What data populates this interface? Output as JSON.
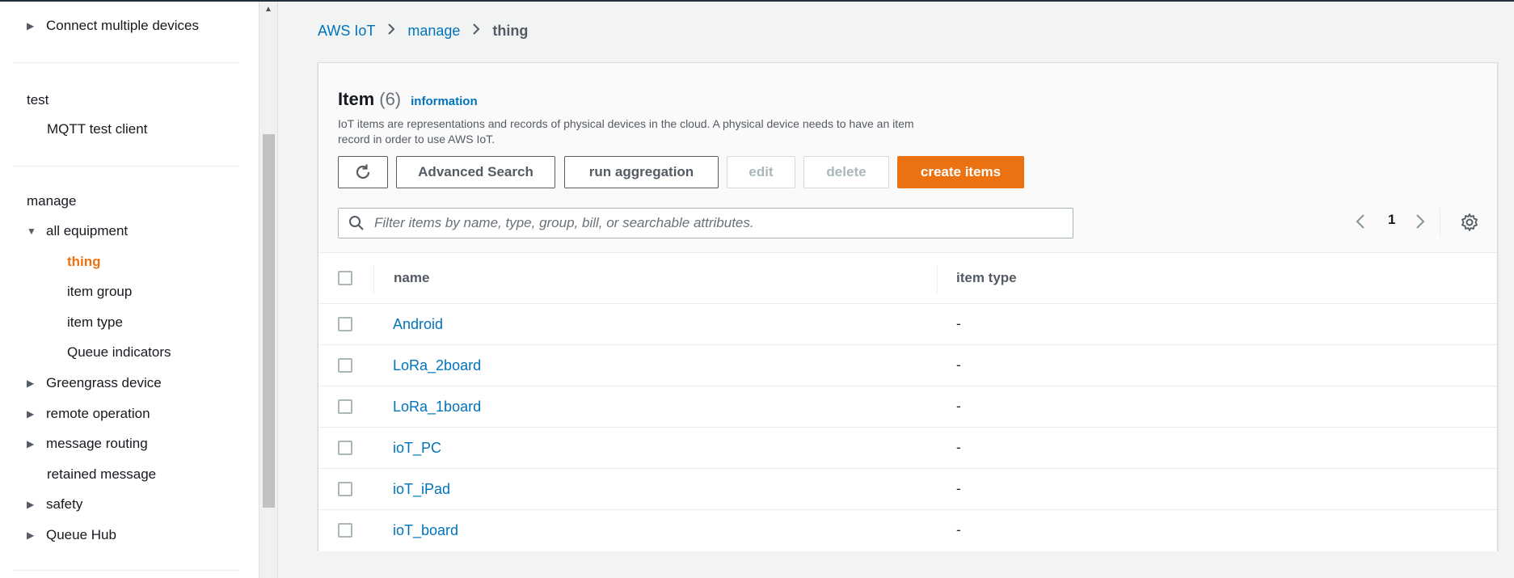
{
  "sidebar": {
    "items": [
      {
        "label": "Connect multiple devices",
        "caret": "right"
      },
      {
        "label": "MQTT test client"
      },
      {
        "label": "all equipment",
        "caret": "down"
      },
      {
        "label": "thing",
        "active": true
      },
      {
        "label": "item group"
      },
      {
        "label": "item type"
      },
      {
        "label": "Queue indicators"
      },
      {
        "label": "Greengrass device",
        "caret": "right"
      },
      {
        "label": "remote operation",
        "caret": "right"
      },
      {
        "label": "message routing",
        "caret": "right"
      },
      {
        "label": "retained message"
      },
      {
        "label": "safety",
        "caret": "right"
      },
      {
        "label": "Queue Hub",
        "caret": "right"
      }
    ],
    "sections": {
      "test": "test",
      "manage": "manage"
    }
  },
  "breadcrumb": {
    "root": "AWS IoT",
    "parent": "manage",
    "current": "thing"
  },
  "panel": {
    "title": "Item",
    "count": "(6)",
    "info_link": "information",
    "description": "IoT items are representations and records of physical devices in the cloud. A physical device needs to have an item record in order to use AWS IoT.",
    "buttons": {
      "refresh": "refresh-icon",
      "advanced_search": "Advanced Search",
      "run_aggregation": "run aggregation",
      "edit": "edit",
      "delete": "delete",
      "create": "create items"
    },
    "search": {
      "placeholder": "Filter items by name, type, group, bill, or searchable attributes."
    },
    "pagination": {
      "page": "1"
    }
  },
  "table": {
    "columns": {
      "name": "name",
      "type": "item type"
    },
    "rows": [
      {
        "name": "Android",
        "type": "-"
      },
      {
        "name": "LoRa_2board",
        "type": "-"
      },
      {
        "name": "LoRa_1board",
        "type": "-"
      },
      {
        "name": "ioT_PC",
        "type": "-"
      },
      {
        "name": "ioT_iPad",
        "type": "-"
      },
      {
        "name": "ioT_board",
        "type": "-"
      }
    ]
  },
  "colors": {
    "accent": "#ec7211",
    "link": "#0073bb",
    "background": "#f2f3f3"
  }
}
